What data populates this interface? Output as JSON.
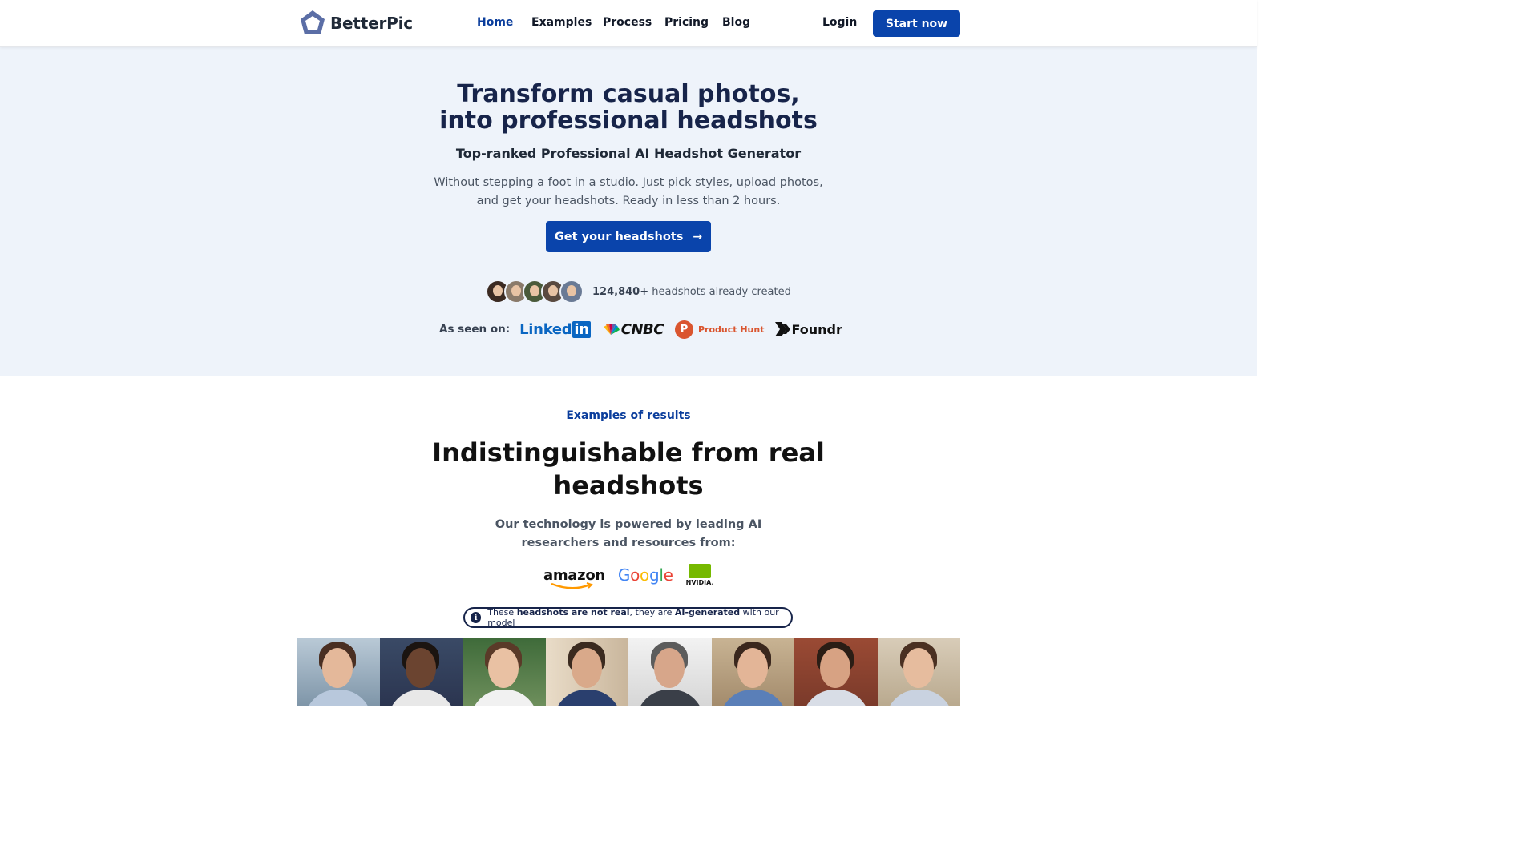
{
  "brand": {
    "name": "BetterPic"
  },
  "nav": {
    "items": [
      "Home",
      "Examples",
      "Process",
      "Pricing",
      "Blog"
    ],
    "active": "Home",
    "login": "Login",
    "start": "Start now"
  },
  "hero": {
    "title_line1": "Transform casual photos,",
    "title_line2": "into professional headshots",
    "subtitle": "Top-ranked Professional AI Headshot Generator",
    "description": "Without stepping a foot in a studio. Just pick styles, upload photos, and get your headshots. Ready in less than 2 hours.",
    "cta": "Get your headshots",
    "cta_icon": "arrow-right-icon",
    "count": "124,840+",
    "count_suffix": " headshots already created",
    "seen_label": "As seen on:",
    "press": {
      "linkedin_a": "Linked",
      "linkedin_b": "in",
      "cnbc": "CNBC",
      "producthunt_letter": "P",
      "producthunt": "Product Hunt",
      "foundr": "Foundr"
    }
  },
  "examples": {
    "eyebrow": "Examples of results",
    "title_line1": "Indistinguishable from real",
    "title_line2": "headshots",
    "desc_line1": "Our technology is powered by leading AI",
    "desc_line2": "researchers and resources from:",
    "ai_logos": {
      "amazon": "amazon",
      "google": [
        "G",
        "o",
        "o",
        "g",
        "l",
        "e"
      ],
      "nvidia": "NVIDIA."
    },
    "notice": {
      "pre": "These ",
      "bold1": "headshots are not real",
      "mid": ", they are ",
      "bold2": "AI-generated",
      "post": " with our model"
    }
  },
  "colors": {
    "primary": "#0a44ab",
    "hero_bg": "#eef3fa",
    "heading": "#17244a"
  }
}
